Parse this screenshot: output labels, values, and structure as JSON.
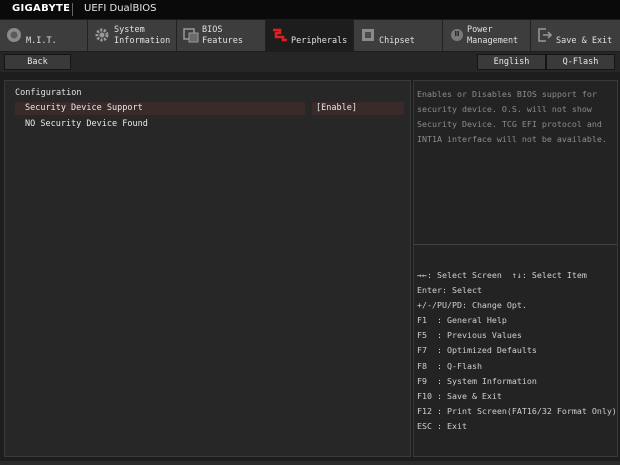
{
  "topbar": {
    "brand": "GIGABYTE",
    "product": "UEFI DualBIOS"
  },
  "tabs": [
    {
      "line1": "M.I.T.",
      "line2": "",
      "icon": "mit-dial-icon",
      "active": false
    },
    {
      "line1": "System",
      "line2": "Information",
      "icon": "gear-icon",
      "active": false
    },
    {
      "line1": "BIOS",
      "line2": "Features",
      "icon": "bios-features-icon",
      "active": false
    },
    {
      "line1": "Peripherals",
      "line2": "",
      "icon": "peripherals-plug-icon",
      "active": true
    },
    {
      "line1": "Chipset",
      "line2": "",
      "icon": "chip-icon",
      "active": false
    },
    {
      "line1": "Power",
      "line2": "Management",
      "icon": "power-plug-icon",
      "active": false
    },
    {
      "line1": "Save & Exit",
      "line2": "",
      "icon": "exit-icon",
      "active": false
    }
  ],
  "subbar": {
    "back": "Back",
    "language": "English",
    "qflash": "Q-Flash"
  },
  "main": {
    "section_title": "Configuration",
    "rows": [
      {
        "name": "Security Device Support",
        "value": "[Enable]"
      },
      {
        "name": "NO Security Device Found",
        "value": ""
      }
    ]
  },
  "help": {
    "description": "Enables or Disables BIOS support for security device. O.S. will not show Security Device. TCG EFI protocol and INT1A interface will not be available.",
    "keys": [
      "→←: Select Screen  ↑↓: Select Item",
      "Enter: Select",
      "+/-/PU/PD: Change Opt.",
      "F1  : General Help",
      "F5  : Previous Values",
      "F7  : Optimized Defaults",
      "F8  : Q-Flash",
      "F9  : System Information",
      "F10 : Save & Exit",
      "F12 : Print Screen(FAT16/32 Format Only)",
      "ESC : Exit"
    ]
  },
  "colors": {
    "accent_red": "#e02020",
    "highlight_row": "#3b2a2a",
    "background": "#1d1d1d"
  }
}
